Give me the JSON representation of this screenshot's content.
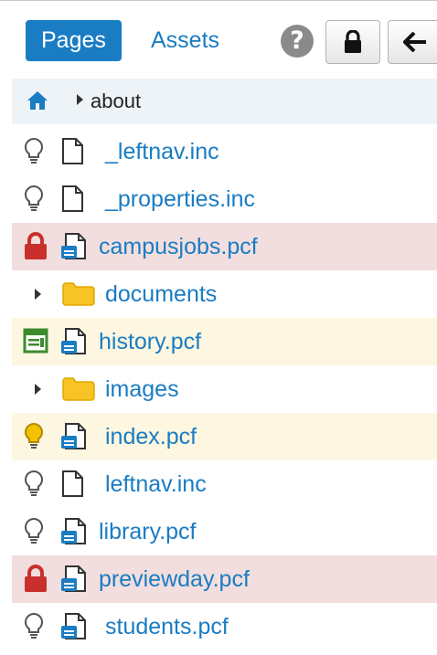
{
  "header": {
    "tabs": [
      {
        "label": "Pages",
        "active": true
      },
      {
        "label": "Assets",
        "active": false
      }
    ],
    "tools": [
      "help-icon",
      "lock-icon",
      "back-arrow-icon"
    ]
  },
  "breadcrumb": {
    "home_icon": "home-icon",
    "current": "about"
  },
  "files": [
    {
      "name": "_leftnav.inc",
      "type": "file",
      "status": "idle",
      "background": "none"
    },
    {
      "name": "_properties.inc",
      "type": "file",
      "status": "idle",
      "background": "none"
    },
    {
      "name": "campusjobs.pcf",
      "type": "pcf",
      "status": "locked",
      "background": "locked"
    },
    {
      "name": "documents",
      "type": "folder"
    },
    {
      "name": "history.pcf",
      "type": "pcf",
      "status": "scheduled",
      "background": "highlight"
    },
    {
      "name": "images",
      "type": "folder"
    },
    {
      "name": "index.pcf",
      "type": "pcf",
      "status": "checked-out",
      "background": "highlight"
    },
    {
      "name": "leftnav.inc",
      "type": "file",
      "status": "idle",
      "background": "none"
    },
    {
      "name": "library.pcf",
      "type": "pcf",
      "status": "idle",
      "background": "none"
    },
    {
      "name": "previewday.pcf",
      "type": "pcf",
      "status": "locked",
      "background": "locked"
    },
    {
      "name": "students.pcf",
      "type": "pcf",
      "status": "idle",
      "background": "none"
    }
  ],
  "colors": {
    "accent": "#1a7cc3",
    "locked_row": "#f2dede",
    "highlight_row": "#fdf7e1",
    "lock_icon": "#c9302c",
    "bulb_active": "#f2c200",
    "folder": "#f7c325",
    "calendar": "#3c8a2e"
  }
}
